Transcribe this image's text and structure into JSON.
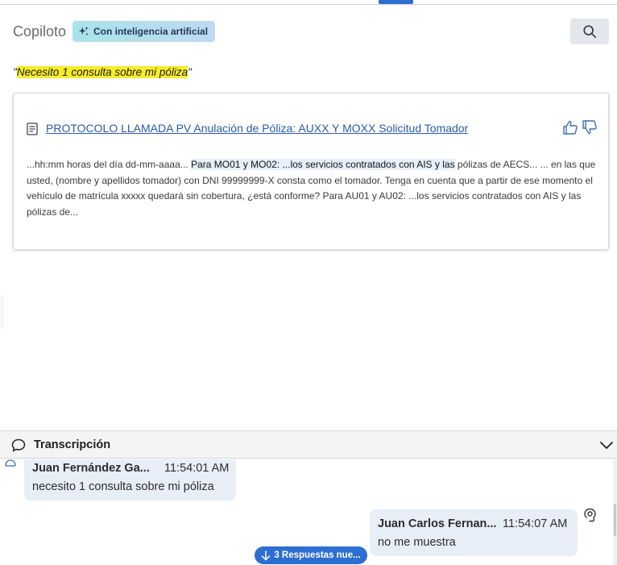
{
  "header": {
    "title": "Copiloto",
    "ai_badge": "Con inteligencia artificial"
  },
  "query": {
    "open_quote": "\"",
    "text": "Necesito 1 consulta sobre mi póliza",
    "close_quote": "\""
  },
  "result_card": {
    "title": "PROTOCOLO LLAMADA PV Anulación de Póliza: AUXX Y MOXX Solicitud Tomador",
    "snippet_before": "...hh:mm horas del día dd-mm-aaaa... ",
    "snippet_highlight": "Para MO01 y MO02: ...los servicios contratados con AIS y las",
    "snippet_after": " pólizas de AECS... ... en las que usted, (nombre y apellidos tomador) con DNI 99999999-X consta como el tomador. Tenga en cuenta que a partir de ese momento el vehículo de matrícula xxxxx quedará sin cobertura, ¿está conforme? Para AU01 y AU02: ...los servicios contratados con AIS y las pólizas de..."
  },
  "transcript": {
    "title": "Transcripción",
    "messages": [
      {
        "name": "Juan Fernández Ga...",
        "time": "11:54:01 AM",
        "text": "necesito 1 consulta sobre mi póliza"
      },
      {
        "name": "Juan Carlos Fernan...",
        "time": "11:54:07 AM",
        "text": "no me muestra"
      }
    ],
    "new_responses_label": "3 Respuestas nue..."
  },
  "colors": {
    "accent": "#2e6ed2",
    "link": "#2b5aa8",
    "query_highlight": "#f7ec2b",
    "bubble": "#e8eef8"
  },
  "icons": [
    "sparkle-icon",
    "search-icon",
    "document-icon",
    "thumbs-up-icon",
    "thumbs-down-icon",
    "chat-bubble-icon",
    "chevron-down-icon",
    "person-icon",
    "agent-headset-icon",
    "arrow-down-icon"
  ]
}
